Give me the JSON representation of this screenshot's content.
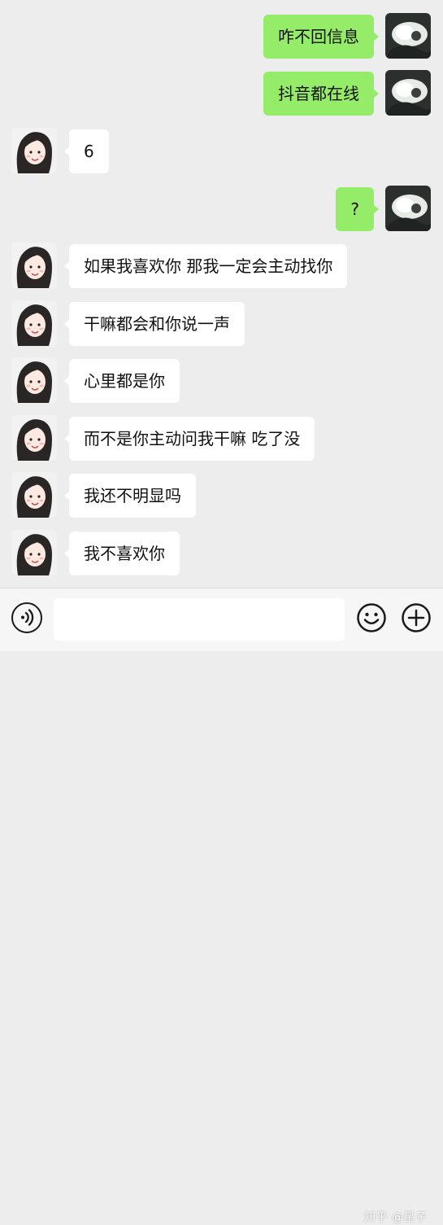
{
  "messages": [
    {
      "side": "right",
      "text": "咋不回信息"
    },
    {
      "side": "right",
      "text": "抖音都在线"
    },
    {
      "side": "left",
      "text": "6"
    },
    {
      "side": "right",
      "text": "?"
    },
    {
      "side": "left",
      "text": "如果我喜欢你 那我一定会主动找你"
    },
    {
      "side": "left",
      "text": "干嘛都会和你说一声"
    },
    {
      "side": "left",
      "text": "心里都是你"
    },
    {
      "side": "left",
      "text": "而不是你主动问我干嘛 吃了没"
    },
    {
      "side": "left",
      "text": "我还不明显吗"
    },
    {
      "side": "left",
      "text": "我不喜欢你"
    }
  ],
  "input": {
    "value": "",
    "voice_icon": "voice-icon",
    "emoji_icon": "emoji-icon",
    "plus_icon": "plus-icon"
  },
  "watermark": "知乎 @星子",
  "colors": {
    "background": "#ededed",
    "sent_bubble": "#95ec69",
    "received_bubble": "#ffffff",
    "input_bar": "#f6f6f6"
  }
}
